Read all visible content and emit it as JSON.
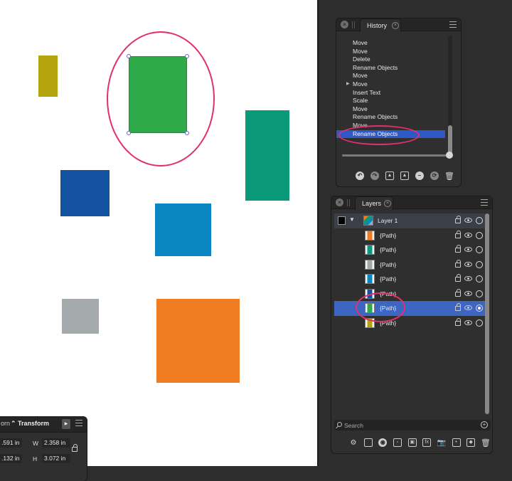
{
  "colors": {
    "olive": "#b6a40e",
    "green_selected": "#2faa4a",
    "teal": "#0a9a7a",
    "blue_dark": "#1352a0",
    "blue_light": "#0a86c2",
    "gray": "#a4a9ab",
    "orange": "#f07d22",
    "annotation_pink": "#e0306e",
    "selection_blue": "#2f58c8"
  },
  "history": {
    "tab_label": "History",
    "items": [
      {
        "label": "Move",
        "expandable": false,
        "selected": false
      },
      {
        "label": "Move",
        "expandable": false,
        "selected": false
      },
      {
        "label": "Delete",
        "expandable": false,
        "selected": false
      },
      {
        "label": "Rename Objects",
        "expandable": false,
        "selected": false
      },
      {
        "label": "Move",
        "expandable": false,
        "selected": false
      },
      {
        "label": "Move",
        "expandable": true,
        "selected": false
      },
      {
        "label": "Insert Text",
        "expandable": false,
        "selected": false
      },
      {
        "label": "Scale",
        "expandable": false,
        "selected": false
      },
      {
        "label": "Move",
        "expandable": false,
        "selected": false
      },
      {
        "label": "Rename Objects",
        "expandable": false,
        "selected": false
      },
      {
        "label": "Move",
        "expandable": false,
        "selected": false
      },
      {
        "label": "Rename Objects",
        "expandable": false,
        "selected": true
      }
    ]
  },
  "layers": {
    "tab_label": "Layers",
    "parent_label": "Layer 1",
    "children": [
      {
        "label": "{Path}",
        "swatch": "#f07d22",
        "selected": false
      },
      {
        "label": "{Path}",
        "swatch": "#0a9a7a",
        "selected": false
      },
      {
        "label": "{Path}",
        "swatch": "#a4a9ab",
        "selected": false
      },
      {
        "label": "{Path}",
        "swatch": "#0a86c2",
        "selected": false
      },
      {
        "label": "{Path}",
        "swatch": "#1352a0",
        "selected": false
      },
      {
        "label": "{Path}",
        "swatch": "#2faa4a",
        "selected": true
      },
      {
        "label": "{Path}",
        "swatch": "#b6a40e",
        "selected": false
      }
    ],
    "search_placeholder": "Search"
  },
  "transform": {
    "clipped_tab": "orn",
    "tab_label": "Transform",
    "x_value": ".591 in",
    "y_value": ".132 in",
    "w_label": "W",
    "w_value": "2.358 in",
    "h_label": "H",
    "h_value": "3.072 in"
  }
}
